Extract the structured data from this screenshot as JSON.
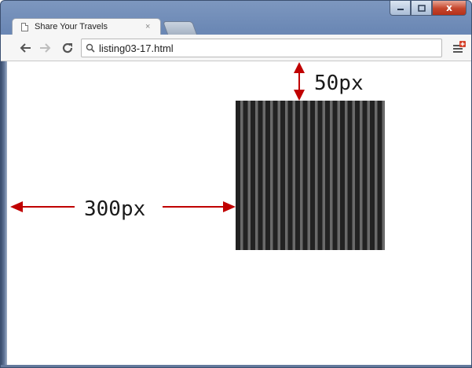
{
  "window": {
    "controls": {
      "minimize_icon": "minimize-icon",
      "maximize_icon": "maximize-icon",
      "close_label": "x"
    }
  },
  "tabs": [
    {
      "label": "Share Your Travels",
      "close_label": "×",
      "icon": "page-icon",
      "active": true
    }
  ],
  "toolbar": {
    "back_icon": "back-arrow-icon",
    "forward_icon": "forward-arrow-icon",
    "reload_icon": "reload-icon",
    "url": "listing03-17.html",
    "menu_icon": "menu-icon"
  },
  "annotations": {
    "top_label": "50px",
    "left_label": "300px",
    "arrow_color": "#c00000"
  },
  "colors": {
    "stripe_dark": "#222222",
    "stripe_light": "#6a6a6a"
  }
}
